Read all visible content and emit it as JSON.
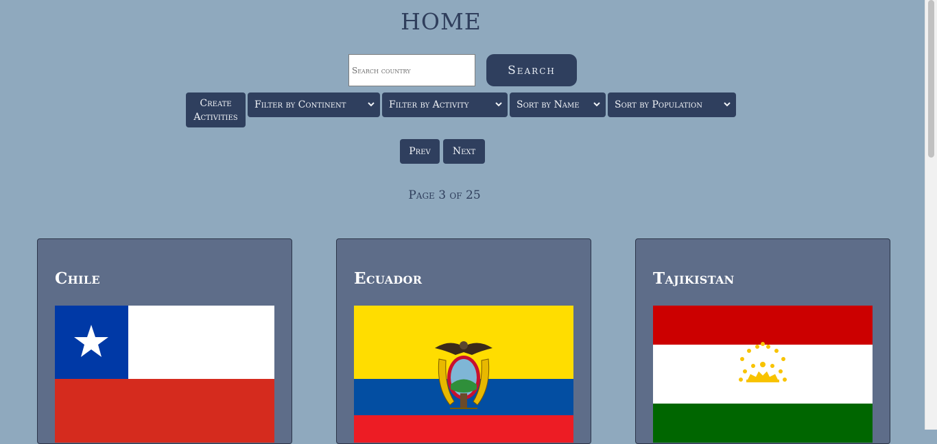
{
  "header": {
    "title": "HOME"
  },
  "search": {
    "placeholder": "Search country",
    "button_label": "Search"
  },
  "toolbar": {
    "create_label_line1": "Create",
    "create_label_line2": "Activities",
    "filter_continent": "Filter by Continent",
    "filter_activity": "Filter by Activity",
    "sort_name": "Sort by Name",
    "sort_population": "Sort by Population"
  },
  "pagination": {
    "prev_label": "Prev",
    "next_label": "Next",
    "page_info": "Page 3 of 25"
  },
  "countries": [
    {
      "name": "Chile",
      "flag_icon": "chile-flag-icon"
    },
    {
      "name": "Ecuador",
      "flag_icon": "ecuador-flag-icon"
    },
    {
      "name": "Tajikistan",
      "flag_icon": "tajikistan-flag-icon"
    }
  ],
  "colors": {
    "background": "#8fa9be",
    "button": "#2f3f5e",
    "card": "#5e6d89",
    "title": "#2f3e5c"
  }
}
